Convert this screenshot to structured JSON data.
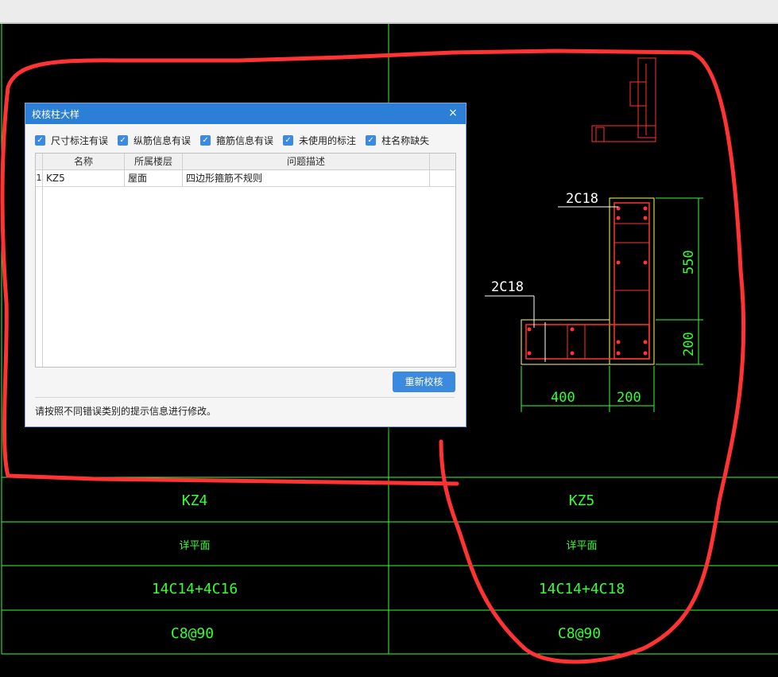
{
  "dialog": {
    "title": "校核柱大样",
    "close_glyph": "×",
    "checks": [
      {
        "label": "尺寸标注有误",
        "checked": true
      },
      {
        "label": "纵筋信息有误",
        "checked": true
      },
      {
        "label": "箍筋信息有误",
        "checked": true
      },
      {
        "label": "未使用的标注",
        "checked": true
      },
      {
        "label": "柱名称缺失",
        "checked": true
      }
    ],
    "columns": [
      "名称",
      "所属楼层",
      "问题描述"
    ],
    "rows": [
      {
        "index": "1",
        "name": "KZ5",
        "floor": "屋面",
        "problem": "四边形箍筋不规则"
      }
    ],
    "recheck_button": "重新校核",
    "hint": "请按照不同错误类别的提示信息进行修改。"
  },
  "drawing": {
    "rebar_top_label": "2C18",
    "rebar_left_label": "2C18",
    "dim_vertical_top": "550",
    "dim_vertical_bottom": "200",
    "dim_horizontal_left": "400",
    "dim_horizontal_right": "200"
  },
  "table": {
    "col_left": {
      "name": "KZ4",
      "section": "详平面",
      "longitudinal": "14C14+4C16",
      "stirrup": "C8@90"
    },
    "col_right": {
      "name": "KZ5",
      "section": "详平面",
      "longitudinal": "14C14+4C18",
      "stirrup": "C8@90"
    }
  },
  "colors": {
    "cad_line": "#33ff33",
    "annotation": "#ff3333",
    "dialog_accent": "#2b7fd6"
  }
}
